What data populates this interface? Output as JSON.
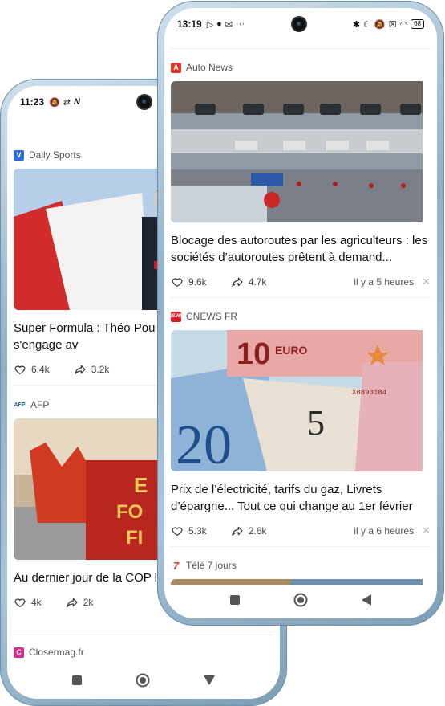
{
  "left_phone": {
    "status_time": "11:23",
    "status_icons": [
      "mute-icon",
      "sync-icon",
      "n-icon"
    ],
    "cards": [
      {
        "source": "Daily Sports",
        "title": "Super Formula : Théo Pou de Formule 2, s'engage av",
        "likes": "6.4k",
        "shares": "3.2k"
      },
      {
        "source": "AFP",
        "title": "Au dernier jour de la COP les énergies fossiles",
        "likes": "4k",
        "shares": "2k"
      },
      {
        "source": "Closermag.fr"
      }
    ]
  },
  "right_phone": {
    "status_time": "13:19",
    "status_icons": [
      "play-icon",
      "ball-icon",
      "mail-icon",
      "more-icon"
    ],
    "status_right_icons": [
      "bluetooth-icon",
      "moon-icon",
      "silent-icon",
      "box-icon",
      "wifi-icon"
    ],
    "battery": "68",
    "cards": [
      {
        "source": "Auto News",
        "title": "Blocage des autoroutes par les agriculteurs : les sociétés d’autoroutes prêtent à demand...",
        "likes": "9.6k",
        "shares": "4.7k",
        "time_ago": "il y a 5 heures"
      },
      {
        "source": "CNEWS FR",
        "title": "Prix de l’électricité, tarifs du gaz, Livrets d’épargne... Tout ce qui change au 1er février",
        "likes": "5.3k",
        "shares": "2.6k",
        "time_ago": "il y a 6 heures"
      },
      {
        "source": "Télé 7 jours"
      }
    ]
  },
  "brand_colors": {
    "daily_sports": "#2b6fd6",
    "afp": "#1b5fbf",
    "closermag": "#d52e8c",
    "auto_news": "#e3322b",
    "cnews": "#d92027",
    "tele7": "#e33a2b"
  }
}
